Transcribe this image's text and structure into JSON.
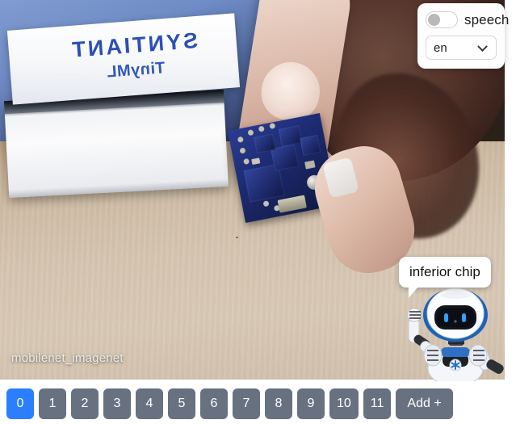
{
  "video": {
    "model_label": "mobilenet_imagenet",
    "scene": {
      "box_top_text": "SYNTIANT",
      "box_top_subtext": "TinyML",
      "alt": "hand-holding-circuit-board"
    }
  },
  "speech_panel": {
    "toggle_label": "speech",
    "toggle_state": "off",
    "language_value": "en",
    "chevron": "chevron-down-icon"
  },
  "assistant": {
    "bubble_text": "inferior chip",
    "avatar": "robot-mascot-icon"
  },
  "class_bar": {
    "buttons": [
      {
        "label": "0",
        "active": true
      },
      {
        "label": "1",
        "active": false
      },
      {
        "label": "2",
        "active": false
      },
      {
        "label": "3",
        "active": false
      },
      {
        "label": "4",
        "active": false
      },
      {
        "label": "5",
        "active": false
      },
      {
        "label": "6",
        "active": false
      },
      {
        "label": "7",
        "active": false
      },
      {
        "label": "8",
        "active": false
      },
      {
        "label": "9",
        "active": false
      },
      {
        "label": "10",
        "active": false
      },
      {
        "label": "11",
        "active": false
      }
    ],
    "add_label": "Add +"
  },
  "colors": {
    "accent_blue": "#2b7fff",
    "button_gray": "#687180",
    "panel_white": "#fdfdfd"
  }
}
